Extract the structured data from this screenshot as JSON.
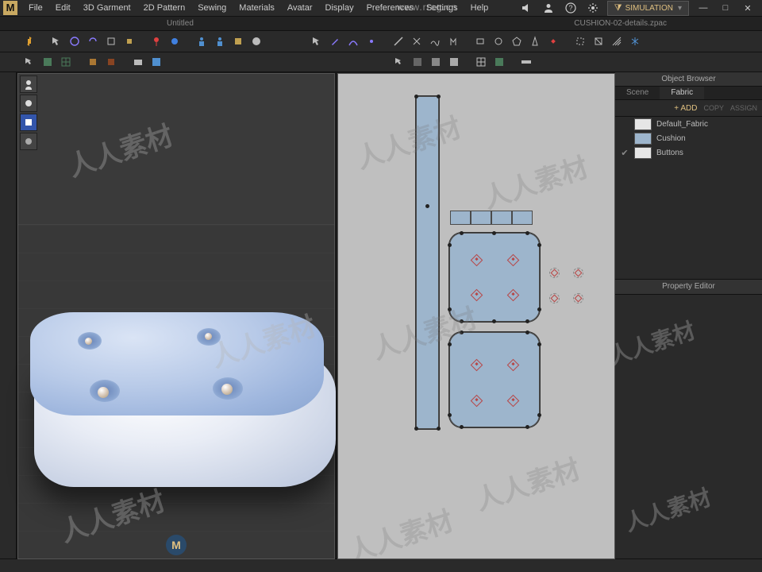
{
  "menu": {
    "items": [
      "File",
      "Edit",
      "3D Garment",
      "2D Pattern",
      "Sewing",
      "Materials",
      "Avatar",
      "Display",
      "Preferences",
      "Settings",
      "Help"
    ]
  },
  "sim": {
    "label": "SIMULATION"
  },
  "tabs": {
    "left": "Untitled",
    "right": "CUSHION-02-details.zpac"
  },
  "urlwm": "www.rrcg.cn",
  "browser": {
    "title": "Object Browser",
    "tabs": [
      "Scene",
      "Fabric"
    ],
    "active": 1,
    "add": "+ ADD",
    "copy": "COPY",
    "assign": "ASSIGN",
    "items": [
      {
        "name": "Default_Fabric",
        "color": "#e6e6e6",
        "eye": ""
      },
      {
        "name": "Cushion",
        "color": "#9db5cc",
        "eye": ""
      },
      {
        "name": "Buttons",
        "color": "#e6e6e6",
        "eye": "✔"
      }
    ]
  },
  "prop": {
    "title": "Property Editor"
  },
  "status": {
    "text": ""
  },
  "wm": "人人素材",
  "chart_data": null
}
